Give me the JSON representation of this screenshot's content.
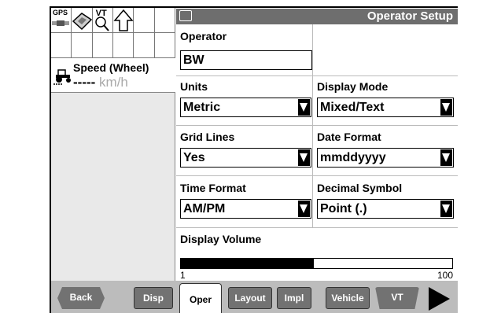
{
  "window": {
    "title": "Operator Setup"
  },
  "icons": {
    "gps_label": "GPS",
    "vt_label": "VT"
  },
  "speed": {
    "title": "Speed (Wheel)",
    "value": "-----",
    "unit": "km/h"
  },
  "form": {
    "operator": {
      "label": "Operator",
      "value": "BW"
    },
    "units": {
      "label": "Units",
      "value": "Metric"
    },
    "display_mode": {
      "label": "Display Mode",
      "value": "Mixed/Text"
    },
    "grid_lines": {
      "label": "Grid Lines",
      "value": "Yes"
    },
    "date_format": {
      "label": "Date Format",
      "value": "mmddyyyy"
    },
    "time_format": {
      "label": "Time Format",
      "value": "AM/PM"
    },
    "decimal_symbol": {
      "label": "Decimal Symbol",
      "value": "Point (.)"
    },
    "display_volume": {
      "label": "Display Volume",
      "min": "1",
      "max": "100",
      "level_fraction": 0.49
    }
  },
  "tabs": {
    "back": "Back",
    "disp": "Disp",
    "oper": "Oper",
    "layout": "Layout",
    "impl": "Impl",
    "vehicle": "Vehicle",
    "vt": "VT"
  }
}
